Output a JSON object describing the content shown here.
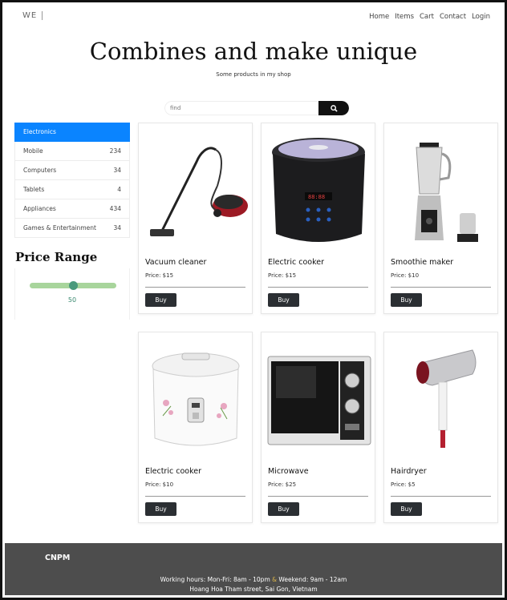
{
  "header": {
    "logo": "WE",
    "nav": [
      "Home",
      "Items",
      "Cart",
      "Contact",
      "Login"
    ],
    "title": "Combines and make unique",
    "subtitle": "Some products in my shop"
  },
  "search": {
    "placeholder": "find",
    "button_icon": "search-icon"
  },
  "categories": [
    {
      "label": "Electronics",
      "count": "",
      "active": true
    },
    {
      "label": "Mobile",
      "count": "234"
    },
    {
      "label": "Computers",
      "count": "34"
    },
    {
      "label": "Tablets",
      "count": "4"
    },
    {
      "label": "Appliances",
      "count": "434"
    },
    {
      "label": "Games & Entertainment",
      "count": "34"
    }
  ],
  "price_range": {
    "title": "Price Range",
    "value": "50",
    "fraction": 0.5
  },
  "products": [
    {
      "name": "Vacuum cleaner",
      "price": "Price: $15",
      "buy": "Buy"
    },
    {
      "name": "Electric cooker",
      "price": "Price: $15",
      "buy": "Buy"
    },
    {
      "name": "Smoothie maker",
      "price": "Price: $10",
      "buy": "Buy"
    },
    {
      "name": "Electric cooker",
      "price": "Price: $10",
      "buy": "Buy"
    },
    {
      "name": "Microwave",
      "price": "Price: $25",
      "buy": "Buy"
    },
    {
      "name": "Hairdryer",
      "price": "Price: $5",
      "buy": "Buy"
    }
  ],
  "footer": {
    "brand": "CNPM",
    "hours_weekday": "Working hours: Mon-Fri: 8am - 10pm",
    "amp": "&",
    "hours_weekend": "Weekend: 9am - 12am",
    "address": "Hoang Hoa Tham street, Sai Gon, Vietnam"
  },
  "colors": {
    "active": "#0a84ff",
    "slider": "#a8d59c",
    "thumb": "#4a9a7c",
    "footer": "#4d4d4d"
  }
}
